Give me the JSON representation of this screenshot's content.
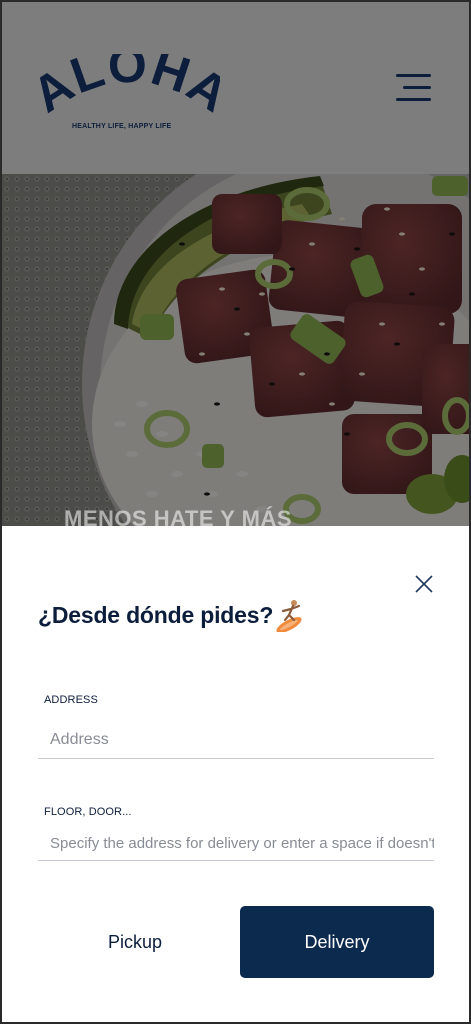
{
  "header": {
    "logo_text": "ALOHA",
    "tagline": "HEALTHY LIFE, HAPPY LIFE",
    "menu_icon": "hamburger-icon"
  },
  "hero": {
    "image": "poke-bowl-photo",
    "caption": "MENOS HATE Y MÁS"
  },
  "modal": {
    "title": "¿Desde dónde pides?",
    "title_icon": "surfer-icon",
    "close_icon": "close-icon",
    "address": {
      "label": "ADDRESS",
      "placeholder": "Address",
      "value": ""
    },
    "floor": {
      "label": "FLOOR, DOOR...",
      "placeholder": "Specify the address for delivery or enter a space if doesn't ap",
      "value": ""
    },
    "pickup_label": "Pickup",
    "delivery_label": "Delivery"
  },
  "colors": {
    "primary": "#0c2a4e",
    "text": "#0c1e3c",
    "overlay": "#7d7d7d",
    "accent": "#f08a3c"
  }
}
